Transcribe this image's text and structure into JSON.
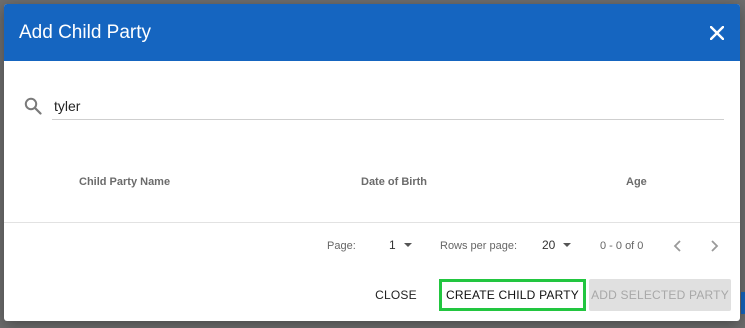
{
  "dialog": {
    "title": "Add Child Party"
  },
  "search": {
    "value": "tyler"
  },
  "table": {
    "columns": [
      "Child Party Name",
      "Date of Birth",
      "Age"
    ]
  },
  "pagination": {
    "page_label": "Page:",
    "page_value": "1",
    "rows_label": "Rows per page:",
    "rows_value": "20",
    "range": "0 - 0 of 0"
  },
  "actions": {
    "close_label": "CLOSE",
    "create_label": "CREATE CHILD PARTY",
    "add_label": "ADD SELECTED PARTY"
  },
  "colors": {
    "header_bg": "#1565c0",
    "highlight_border": "#22c640",
    "disabled_bg": "#e0e0e0"
  }
}
